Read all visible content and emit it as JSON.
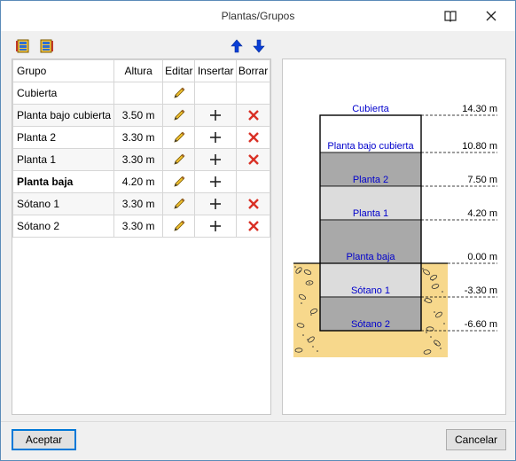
{
  "window": {
    "title": "Plantas/Grupos"
  },
  "table": {
    "headers": {
      "grupo": "Grupo",
      "altura": "Altura",
      "editar": "Editar",
      "insertar": "Insertar",
      "borrar": "Borrar"
    },
    "rows": [
      {
        "name": "Cubierta",
        "height": "",
        "bold": false,
        "insert": false,
        "delete": false
      },
      {
        "name": "Planta bajo cubierta",
        "height": "3.50 m",
        "bold": false,
        "insert": true,
        "delete": true
      },
      {
        "name": "Planta 2",
        "height": "3.30 m",
        "bold": false,
        "insert": true,
        "delete": true
      },
      {
        "name": "Planta 1",
        "height": "3.30 m",
        "bold": false,
        "insert": true,
        "delete": true
      },
      {
        "name": "Planta baja",
        "height": "4.20 m",
        "bold": true,
        "insert": true,
        "delete": false
      },
      {
        "name": "Sótano 1",
        "height": "3.30 m",
        "bold": false,
        "insert": true,
        "delete": true
      },
      {
        "name": "Sótano 2",
        "height": "3.30 m",
        "bold": false,
        "insert": true,
        "delete": true
      }
    ]
  },
  "diagram": {
    "floors": [
      {
        "label": "Cubierta",
        "level": "14.30 m"
      },
      {
        "label": "Planta bajo cubierta",
        "level": "10.80 m"
      },
      {
        "label": "Planta 2",
        "level": "7.50 m"
      },
      {
        "label": "Planta 1",
        "level": "4.20 m"
      },
      {
        "label": "Planta baja",
        "level": "0.00 m"
      },
      {
        "label": "Sótano 1",
        "level": "-3.30 m"
      },
      {
        "label": "Sótano 2",
        "level": "-6.60 m"
      }
    ],
    "colors": {
      "label": "#0000cc",
      "dark_slab": "#a9a9a9",
      "light_slab": "#dcdcdc",
      "ground": "#f7d88c"
    }
  },
  "buttons": {
    "accept": "Aceptar",
    "cancel": "Cancelar"
  }
}
